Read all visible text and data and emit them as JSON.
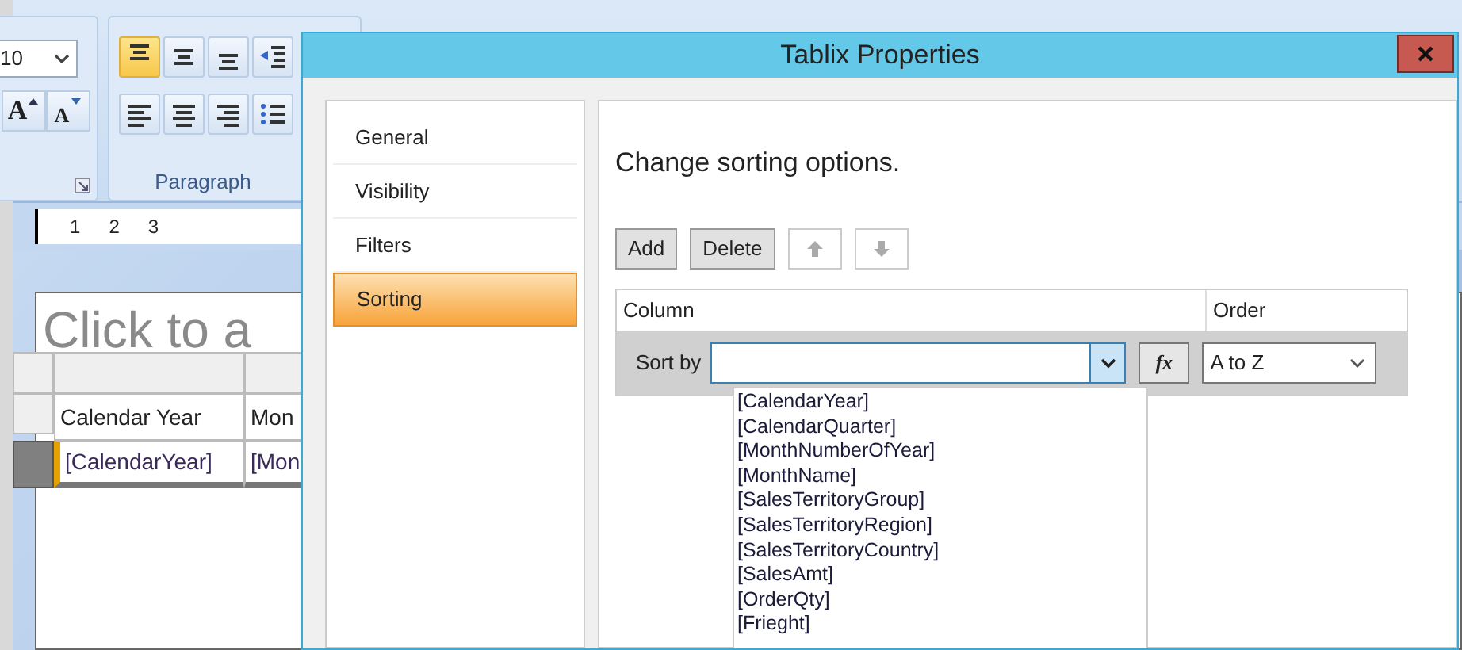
{
  "ribbon": {
    "font_size": "10",
    "font_buttons": [
      {
        "label": "A",
        "kind": "grow"
      },
      {
        "label": "A",
        "kind": "shrink"
      }
    ],
    "align_buttons": [
      {
        "kind": "top",
        "selected": true
      },
      {
        "kind": "middle",
        "selected": false
      },
      {
        "kind": "bottom",
        "selected": false
      },
      {
        "kind": "indent",
        "selected": false
      },
      {
        "kind": "left",
        "selected": false
      },
      {
        "kind": "center",
        "selected": false
      },
      {
        "kind": "right",
        "selected": false
      },
      {
        "kind": "bullets",
        "selected": false
      }
    ],
    "group_label": "Paragraph"
  },
  "ruler": [
    "1",
    "2",
    "3"
  ],
  "report": {
    "title_placeholder": "Click to a",
    "header_cells": [
      "Calendar Year",
      "Mon"
    ],
    "data_cells": [
      "[CalendarYear]",
      "[Mon"
    ]
  },
  "dialog": {
    "title": "Tablix Properties",
    "nav": [
      {
        "label": "General",
        "selected": false
      },
      {
        "label": "Visibility",
        "selected": false
      },
      {
        "label": "Filters",
        "selected": false
      },
      {
        "label": "Sorting",
        "selected": true
      }
    ],
    "heading": "Change sorting options.",
    "buttons": [
      {
        "kind": "text",
        "label": "Add",
        "disabled": false
      },
      {
        "kind": "text",
        "label": "Delete",
        "disabled": false
      },
      {
        "kind": "up",
        "disabled": true
      },
      {
        "kind": "down",
        "disabled": true
      }
    ],
    "columns": [
      "Column",
      "Order"
    ],
    "sort_row": {
      "label": "Sort by",
      "fx": "fx",
      "order": "A to Z"
    },
    "options": [
      "[CalendarYear]",
      "[CalendarQuarter]",
      "[MonthNumberOfYear]",
      "[MonthName]",
      "[SalesTerritoryGroup]",
      "[SalesTerritoryRegion]",
      "[SalesTerritoryCountry]",
      "[SalesAmt]",
      "[OrderQty]",
      "[Frieght]"
    ]
  }
}
